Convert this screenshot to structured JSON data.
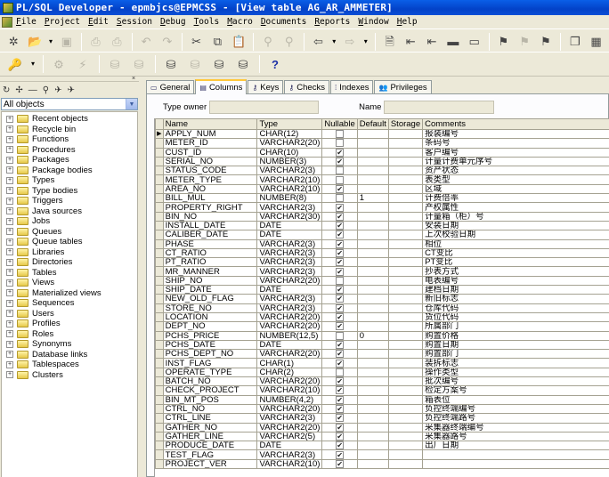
{
  "window": {
    "title": "PL/SQL Developer - epmbjcs@EPMCSS - [View table AG_AR_AMMETER]"
  },
  "menu": [
    "File",
    "Project",
    "Edit",
    "Session",
    "Debug",
    "Tools",
    "Macro",
    "Documents",
    "Reports",
    "Window",
    "Help"
  ],
  "toolbar1": [
    {
      "name": "new-icon",
      "glyph": "✲",
      "enabled": true
    },
    {
      "name": "open-icon",
      "glyph": "📂",
      "enabled": true
    },
    {
      "name": "dropdown-arrow-icon",
      "glyph": "▾",
      "enabled": true,
      "small": true
    },
    {
      "name": "save-icon",
      "glyph": "▣",
      "enabled": false
    },
    {
      "sep": true
    },
    {
      "name": "print-icon",
      "glyph": "⎙",
      "enabled": false
    },
    {
      "name": "print-preview-icon",
      "glyph": "⎙",
      "enabled": false
    },
    {
      "sep": true
    },
    {
      "name": "undo-icon",
      "glyph": "↶",
      "enabled": false
    },
    {
      "name": "redo-icon",
      "glyph": "↷",
      "enabled": false
    },
    {
      "sep": true
    },
    {
      "name": "cut-icon",
      "glyph": "✂",
      "enabled": true
    },
    {
      "name": "copy-icon",
      "glyph": "⧉",
      "enabled": true
    },
    {
      "name": "paste-icon",
      "glyph": "📋",
      "enabled": true
    },
    {
      "sep": true
    },
    {
      "name": "find-icon",
      "glyph": "⚲",
      "enabled": false
    },
    {
      "name": "find-next-icon",
      "glyph": "⚲",
      "enabled": false
    },
    {
      "sep": true
    },
    {
      "name": "load-icon",
      "glyph": "⇦",
      "enabled": true
    },
    {
      "name": "dropdown-arrow-icon",
      "glyph": "▾",
      "enabled": true,
      "small": true
    },
    {
      "name": "execute-icon",
      "glyph": "⇨",
      "enabled": false
    },
    {
      "name": "dropdown-arrow-icon",
      "glyph": "▾",
      "enabled": false,
      "small": true
    },
    {
      "sep": true
    },
    {
      "name": "compile-icon",
      "glyph": "🗎",
      "enabled": true
    },
    {
      "name": "indent-icon",
      "glyph": "⇤",
      "enabled": true
    },
    {
      "name": "unindent-icon",
      "glyph": "⇤",
      "enabled": true
    },
    {
      "name": "comment-icon",
      "glyph": "▬",
      "enabled": true
    },
    {
      "name": "uncomment-icon",
      "glyph": "▭",
      "enabled": true
    },
    {
      "sep": true
    },
    {
      "name": "bookmark-toggle-icon",
      "glyph": "⚑",
      "enabled": true
    },
    {
      "name": "bookmark-next-icon",
      "glyph": "⚑",
      "enabled": false
    },
    {
      "name": "bookmark-list-icon",
      "glyph": "⚑",
      "enabled": true
    },
    {
      "sep": true
    },
    {
      "name": "cascade-windows-icon",
      "glyph": "❐",
      "enabled": true
    },
    {
      "name": "tile-windows-icon",
      "glyph": "▦",
      "enabled": true
    }
  ],
  "toolbar2": [
    {
      "name": "key-icon",
      "glyph": "🔑",
      "enabled": true
    },
    {
      "name": "dropdown-arrow-icon",
      "glyph": "▾",
      "enabled": true,
      "small": true
    },
    {
      "sep": true
    },
    {
      "name": "debug-gear-icon",
      "glyph": "⚙",
      "enabled": false
    },
    {
      "name": "break-icon",
      "glyph": "⚡",
      "enabled": false
    },
    {
      "sep": true
    },
    {
      "name": "commit-icon",
      "glyph": "⛁",
      "enabled": false
    },
    {
      "name": "rollback-icon",
      "glyph": "⛁",
      "enabled": false
    },
    {
      "sep": true
    },
    {
      "name": "log-on-icon",
      "glyph": "⛁",
      "enabled": true
    },
    {
      "name": "sql-trace-icon",
      "glyph": "⛁",
      "enabled": false
    },
    {
      "name": "session-icon",
      "glyph": "⛁",
      "enabled": true
    },
    {
      "name": "log-off-icon",
      "glyph": "⛁",
      "enabled": true
    },
    {
      "sep": true
    },
    {
      "name": "help-icon",
      "glyph": "?",
      "enabled": true
    }
  ],
  "browser": {
    "tools": [
      "↻",
      "✢",
      "—",
      "⚲",
      "✈",
      "✈"
    ],
    "filter": "All objects",
    "items": [
      "Recent objects",
      "Recycle bin",
      "Functions",
      "Procedures",
      "Packages",
      "Package bodies",
      "Types",
      "Type bodies",
      "Triggers",
      "Java sources",
      "Jobs",
      "Queues",
      "Queue tables",
      "Libraries",
      "Directories",
      "Tables",
      "Views",
      "Materialized views",
      "Sequences",
      "Users",
      "Profiles",
      "Roles",
      "Synonyms",
      "Database links",
      "Tablespaces",
      "Clusters"
    ]
  },
  "tabs": [
    {
      "label": "General",
      "icon": "▭",
      "active": false
    },
    {
      "label": "Columns",
      "icon": "▤",
      "active": true
    },
    {
      "label": "Keys",
      "icon": "⚷",
      "active": false
    },
    {
      "label": "Checks",
      "icon": "⚷",
      "active": false
    },
    {
      "label": "Indexes",
      "icon": "⁞",
      "active": false
    },
    {
      "label": "Privileges",
      "icon": "👥",
      "active": false
    }
  ],
  "form": {
    "type_owner_label": "Type owner",
    "type_owner_value": "",
    "name_label": "Name",
    "name_value": ""
  },
  "grid": {
    "headers": [
      "Name",
      "Type",
      "Nullable",
      "Default",
      "Storage",
      "Comments"
    ],
    "rows": [
      {
        "name": "APPLY_NUM",
        "type": "CHAR(12)",
        "nullable": false,
        "default": "",
        "storage": "",
        "comment": "报装编号",
        "current": true
      },
      {
        "name": "METER_ID",
        "type": "VARCHAR2(20)",
        "nullable": false,
        "default": "",
        "storage": "",
        "comment": "条码号"
      },
      {
        "name": "CUST_ID",
        "type": "CHAR(10)",
        "nullable": true,
        "default": "",
        "storage": "",
        "comment": "客户编号"
      },
      {
        "name": "SERIAL_NO",
        "type": "NUMBER(3)",
        "nullable": true,
        "default": "",
        "storage": "",
        "comment": "计量计费单元序号"
      },
      {
        "name": "STATUS_CODE",
        "type": "VARCHAR2(3)",
        "nullable": false,
        "default": "",
        "storage": "",
        "comment": "资产状态"
      },
      {
        "name": "METER_TYPE",
        "type": "VARCHAR2(10)",
        "nullable": false,
        "default": "",
        "storage": "",
        "comment": "表类型"
      },
      {
        "name": "AREA_NO",
        "type": "VARCHAR2(10)",
        "nullable": true,
        "default": "",
        "storage": "",
        "comment": "区域"
      },
      {
        "name": "BILL_MUL",
        "type": "NUMBER(8)",
        "nullable": false,
        "default": "1",
        "storage": "",
        "comment": "计费倍率"
      },
      {
        "name": "PROPERTY_RIGHT",
        "type": "VARCHAR2(3)",
        "nullable": true,
        "default": "",
        "storage": "",
        "comment": "产权属性"
      },
      {
        "name": "BIN_NO",
        "type": "VARCHAR2(30)",
        "nullable": true,
        "default": "",
        "storage": "",
        "comment": "计量箱（柜）号"
      },
      {
        "name": "INSTALL_DATE",
        "type": "DATE",
        "nullable": true,
        "default": "",
        "storage": "",
        "comment": "安装日期"
      },
      {
        "name": "CALIBER_DATE",
        "type": "DATE",
        "nullable": true,
        "default": "",
        "storage": "",
        "comment": "上次校验日期"
      },
      {
        "name": "PHASE",
        "type": "VARCHAR2(3)",
        "nullable": true,
        "default": "",
        "storage": "",
        "comment": "相位"
      },
      {
        "name": "CT_RATIO",
        "type": "VARCHAR2(3)",
        "nullable": true,
        "default": "",
        "storage": "",
        "comment": "CT变比"
      },
      {
        "name": "PT_RATIO",
        "type": "VARCHAR2(3)",
        "nullable": true,
        "default": "",
        "storage": "",
        "comment": "PT变比"
      },
      {
        "name": "MR_MANNER",
        "type": "VARCHAR2(3)",
        "nullable": true,
        "default": "",
        "storage": "",
        "comment": "抄表方式"
      },
      {
        "name": "SHIP_NO",
        "type": "VARCHAR2(20)",
        "nullable": false,
        "default": "",
        "storage": "",
        "comment": "电表编号"
      },
      {
        "name": "SHIP_DATE",
        "type": "DATE",
        "nullable": true,
        "default": "",
        "storage": "",
        "comment": "建档日期"
      },
      {
        "name": "NEW_OLD_FLAG",
        "type": "VARCHAR2(3)",
        "nullable": true,
        "default": "",
        "storage": "",
        "comment": "新旧标志"
      },
      {
        "name": "STORE_NO",
        "type": "VARCHAR2(3)",
        "nullable": true,
        "default": "",
        "storage": "",
        "comment": "仓库代码"
      },
      {
        "name": "LOCATION",
        "type": "VARCHAR2(20)",
        "nullable": true,
        "default": "",
        "storage": "",
        "comment": "货位代码"
      },
      {
        "name": "DEPT_NO",
        "type": "VARCHAR2(20)",
        "nullable": true,
        "default": "",
        "storage": "",
        "comment": "所属部门"
      },
      {
        "name": "PCHS_PRICE",
        "type": "NUMBER(12,5)",
        "nullable": false,
        "default": "0",
        "storage": "",
        "comment": "购置价格"
      },
      {
        "name": "PCHS_DATE",
        "type": "DATE",
        "nullable": true,
        "default": "",
        "storage": "",
        "comment": "购置日期"
      },
      {
        "name": "PCHS_DEPT_NO",
        "type": "VARCHAR2(20)",
        "nullable": true,
        "default": "",
        "storage": "",
        "comment": "购置部门"
      },
      {
        "name": "INST_FLAG",
        "type": "CHAR(1)",
        "nullable": true,
        "default": "",
        "storage": "",
        "comment": "装拆标志"
      },
      {
        "name": "OPERATE_TYPE",
        "type": "CHAR(2)",
        "nullable": false,
        "default": "",
        "storage": "",
        "comment": "操作类型"
      },
      {
        "name": "BATCH_NO",
        "type": "VARCHAR2(20)",
        "nullable": true,
        "default": "",
        "storage": "",
        "comment": "批次编号"
      },
      {
        "name": "CHECK_PROJECT",
        "type": "VARCHAR2(10)",
        "nullable": true,
        "default": "",
        "storage": "",
        "comment": "检定方案号"
      },
      {
        "name": "BIN_MT_POS",
        "type": "NUMBER(4,2)",
        "nullable": true,
        "default": "",
        "storage": "",
        "comment": "箱表位"
      },
      {
        "name": "CTRL_NO",
        "type": "VARCHAR2(20)",
        "nullable": true,
        "default": "",
        "storage": "",
        "comment": "负控终端编号"
      },
      {
        "name": "CTRL_LINE",
        "type": "VARCHAR2(3)",
        "nullable": true,
        "default": "",
        "storage": "",
        "comment": "负控终端路号"
      },
      {
        "name": "GATHER_NO",
        "type": "VARCHAR2(20)",
        "nullable": true,
        "default": "",
        "storage": "",
        "comment": "采集器终端编号"
      },
      {
        "name": "GATHER_LINE",
        "type": "VARCHAR2(5)",
        "nullable": true,
        "default": "",
        "storage": "",
        "comment": "采集器路号"
      },
      {
        "name": "PRODUCE_DATE",
        "type": "DATE",
        "nullable": true,
        "default": "",
        "storage": "",
        "comment": "出厂日期"
      },
      {
        "name": "TEST_FLAG",
        "type": "VARCHAR2(3)",
        "nullable": true,
        "default": "",
        "storage": "",
        "comment": ""
      },
      {
        "name": "PROJECT_VER",
        "type": "VARCHAR2(10)",
        "nullable": true,
        "default": "",
        "storage": "",
        "comment": ""
      }
    ]
  }
}
